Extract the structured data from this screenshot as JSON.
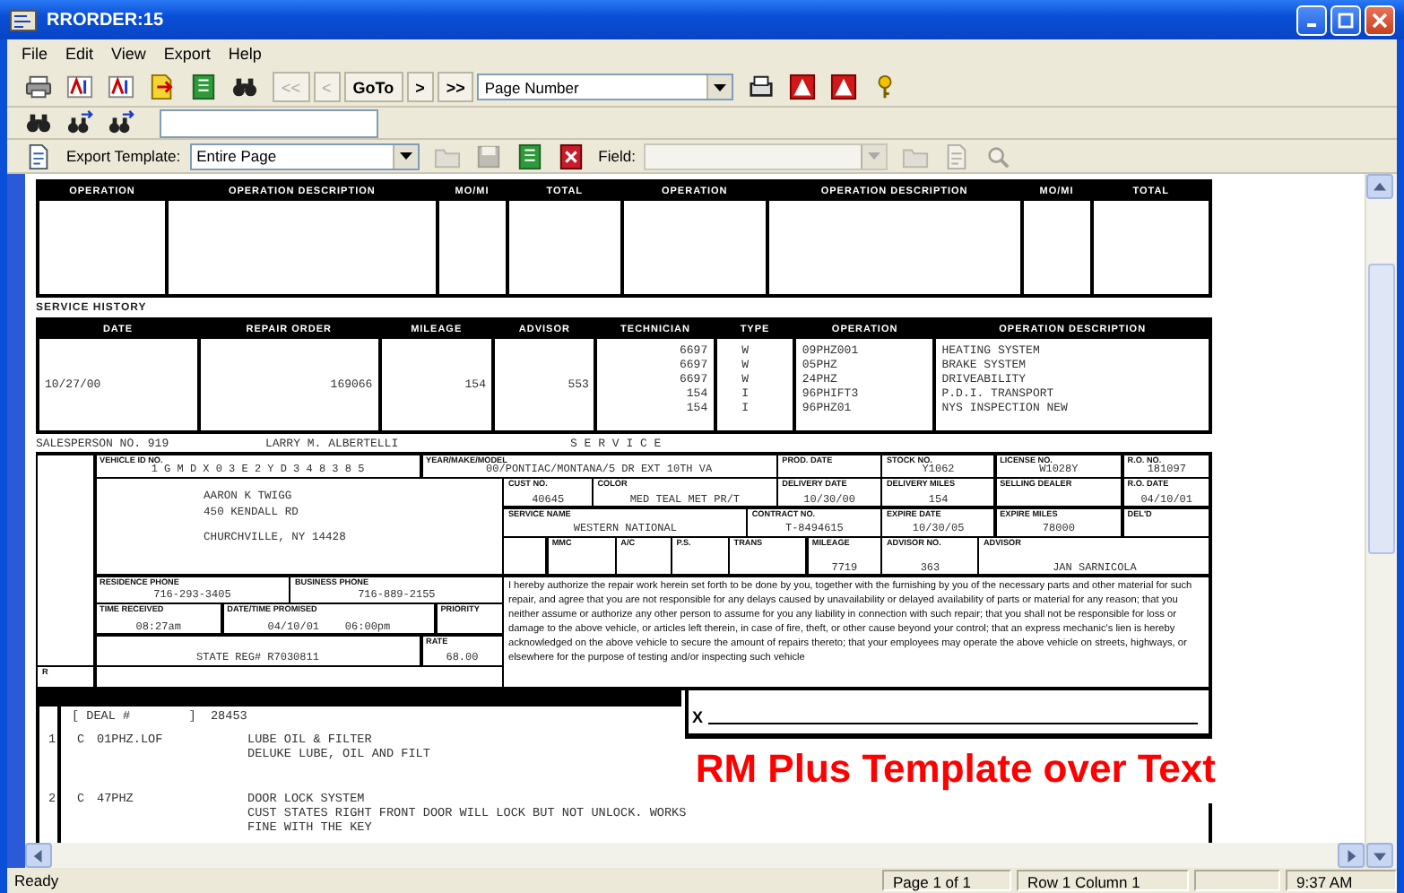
{
  "window": {
    "title": "RRORDER:15"
  },
  "menu": [
    {
      "label": "File"
    },
    {
      "label": "Edit"
    },
    {
      "label": "View"
    },
    {
      "label": "Export"
    },
    {
      "label": "Help"
    }
  ],
  "toolbar": {
    "items": [
      {
        "kind": "icon"
      },
      {
        "kind": "icon"
      },
      {
        "kind": "icon"
      },
      {
        "kind": "icon"
      },
      {
        "kind": "icon"
      },
      {
        "kind": "icon"
      },
      {
        "kind": "button",
        "label": "<<",
        "disabled": true
      },
      {
        "kind": "button",
        "label": "<",
        "disabled": true
      },
      {
        "kind": "button",
        "label": "GoTo",
        "disabled": false
      },
      {
        "kind": "button",
        "label": ">",
        "disabled": false
      },
      {
        "kind": "button",
        "label": ">>",
        "disabled": false
      },
      {
        "kind": "select",
        "value": "Page Number",
        "disabled": false
      },
      {
        "kind": "icon"
      },
      {
        "kind": "icon"
      },
      {
        "kind": "icon"
      },
      {
        "kind": "icon"
      }
    ]
  },
  "finder_bar": {
    "items": [
      {
        "kind": "icon"
      },
      {
        "kind": "icon"
      },
      {
        "kind": "icon"
      },
      {
        "kind": "input"
      }
    ]
  },
  "export_bar": {
    "items": [
      {
        "kind": "icon",
        "disabled": false
      },
      {
        "kind": "label",
        "text": "Export Template:"
      },
      {
        "kind": "select",
        "value": "Entire Page",
        "disabled": false
      },
      {
        "kind": "icon",
        "disabled": true
      },
      {
        "kind": "icon",
        "disabled": true
      },
      {
        "kind": "icon",
        "disabled": false
      },
      {
        "kind": "icon",
        "disabled": false
      },
      {
        "kind": "label",
        "text": "Field:"
      },
      {
        "kind": "select",
        "disabled": true
      },
      {
        "kind": "icon",
        "disabled": true
      },
      {
        "kind": "icon",
        "disabled": true
      },
      {
        "kind": "icon",
        "disabled": true
      }
    ]
  },
  "document": {
    "operations_table": {
      "columns": [
        "OPERATION",
        "OPERATION DESCRIPTION",
        "MO/MI",
        "TOTAL",
        "OPERATION",
        "OPERATION DESCRIPTION",
        "MO/MI",
        "TOTAL"
      ]
    },
    "service_history": {
      "title": "SERVICE HISTORY",
      "columns": [
        "DATE",
        "REPAIR ORDER",
        "MILEAGE",
        "ADVISOR",
        "TECHNICIAN",
        "TYPE",
        "OPERATION",
        "OPERATION DESCRIPTION"
      ],
      "rows": [
        {
          "date": "10/27/00",
          "repair_order": "169066",
          "mileage": "154",
          "advisor": "553",
          "lines": [
            {
              "technician": "6697",
              "type": "W",
              "operation": "09PHZ001",
              "description": "HEATING SYSTEM"
            },
            {
              "technician": "6697",
              "type": "W",
              "operation": "05PHZ",
              "description": "BRAKE SYSTEM"
            },
            {
              "technician": "6697",
              "type": "W",
              "operation": "24PHZ",
              "description": "DRIVEABILITY"
            },
            {
              "technician": "154",
              "type": "I",
              "operation": "96PHIFT3",
              "description": "P.D.I. TRANSPORT"
            },
            {
              "technician": "154",
              "type": "I",
              "operation": "96PHZ01",
              "description": "NYS INSPECTION NEW"
            }
          ]
        }
      ]
    },
    "salesperson": {
      "number": "SALESPERSON NO. 919",
      "name": "LARRY M. ALBERTELLI",
      "department": "S E R V I C E"
    },
    "form": {
      "fields": [
        {
          "kind": "field",
          "label": "VEHICLE ID NO.",
          "value": "1 G M D X 0 3 E 2 Y D 3 4 8 3 8 5"
        },
        {
          "kind": "field",
          "label": "YEAR/MAKE/MODEL",
          "value": "00/PONTIAC/MONTANA/5 DR EXT 10TH VA"
        },
        {
          "kind": "field",
          "label": "PROD. DATE"
        },
        {
          "kind": "field",
          "label": "STOCK NO.",
          "value": "Y1062"
        },
        {
          "kind": "field",
          "label": "LICENSE NO.",
          "value": "W1028Y"
        },
        {
          "kind": "field",
          "label": "R.O. NO.",
          "value": "181097"
        },
        {
          "kind": "address",
          "lines": [
            "AARON K TWIGG",
            "450 KENDALL RD",
            "CHURCHVILLE, NY 14428"
          ]
        },
        {
          "kind": "field",
          "label": "CUST NO.",
          "value": "40645"
        },
        {
          "kind": "field",
          "label": "COLOR",
          "value": "MED TEAL MET PR/T"
        },
        {
          "kind": "field",
          "label": "DELIVERY DATE",
          "value": "10/30/00"
        },
        {
          "kind": "field",
          "label": "DELIVERY MILES",
          "value": "154"
        },
        {
          "kind": "field",
          "label": "SELLING DEALER"
        },
        {
          "kind": "field",
          "label": "R.O. DATE",
          "value": "04/10/01"
        },
        {
          "kind": "field",
          "label": "SERVICE NAME",
          "value": "WESTERN NATIONAL"
        },
        {
          "kind": "field",
          "label": "CONTRACT NO.",
          "value": "T-8494615"
        },
        {
          "kind": "field",
          "label": "EXPIRE DATE",
          "value": "10/30/05"
        },
        {
          "kind": "field",
          "label": "EXPIRE MILES",
          "value": "78000"
        },
        {
          "kind": "field",
          "label": "DEL'D"
        },
        {
          "kind": "field",
          "label": "MMC"
        },
        {
          "kind": "field",
          "label": "A/C"
        },
        {
          "kind": "field",
          "label": "P.S."
        },
        {
          "kind": "field",
          "label": "TRANS"
        },
        {
          "kind": "field",
          "label": "MILEAGE",
          "value": "7719"
        },
        {
          "kind": "field",
          "label": "ADVISOR NO.",
          "value": "363"
        },
        {
          "kind": "field",
          "label": "ADVISOR",
          "value": "JAN SARNICOLA"
        },
        {
          "kind": "field",
          "label": "RESIDENCE PHONE",
          "value": "716-293-3405"
        },
        {
          "kind": "field",
          "label": "BUSINESS PHONE",
          "value": "716-889-2155"
        },
        {
          "kind": "field",
          "label": "TIME RECEIVED",
          "value": "08:27am"
        },
        {
          "kind": "field",
          "label": "DATE/TIME PROMISED",
          "value": "04/10/01    06:00pm"
        },
        {
          "kind": "field",
          "label": "PRIORITY"
        },
        {
          "kind": "field",
          "value": "STATE REG# R7030811"
        },
        {
          "kind": "field",
          "label": "RATE",
          "value": "68.00"
        },
        {
          "kind": "field",
          "label": "R"
        },
        {
          "kind": "notice",
          "text": "I hereby authorize the repair work herein set forth to be done by you, together with the furnishing by you of the necessary parts and other material for such repair, and agree that you are not responsible for any delays caused by unavailability or delayed availability of parts or material for any reason; that you neither assume or authorize any other person to assume for you any liability in connection with such repair; that you shall not be responsible for loss or damage to the above vehicle, or articles left therein, in case of fire, theft, or other cause beyond your control; that an express mechanic's lien is hereby acknowledged on the above vehicle to secure the amount of repairs thereto; that your employees may operate the above vehicle on streets, highways, or elsewhere for the purpose of testing and/or inspecting such vehicle"
        }
      ]
    },
    "listing": {
      "deal": "[ DEAL #        ]  28453",
      "lines": [
        {
          "number": "1",
          "type": "C",
          "code": "01PHZ.LOF",
          "text": [
            "LUBE OIL & FILTER",
            "DELUKE LUBE, OIL AND FILT"
          ]
        },
        {
          "number": "2",
          "type": "C",
          "code": "47PHZ",
          "text": [
            "DOOR LOCK SYSTEM",
            "CUST STATES RIGHT FRONT DOOR WILL LOCK BUT NOT UNLOCK. WORKS",
            "FINE WITH THE KEY"
          ]
        }
      ]
    },
    "signature": {
      "mark": "X"
    }
  },
  "caption": "RM Plus Template over Text",
  "status_bar": {
    "message": "Ready",
    "page": "Page 1 of 1",
    "position": "Row 1 Column 1",
    "time": "9:37 AM"
  }
}
